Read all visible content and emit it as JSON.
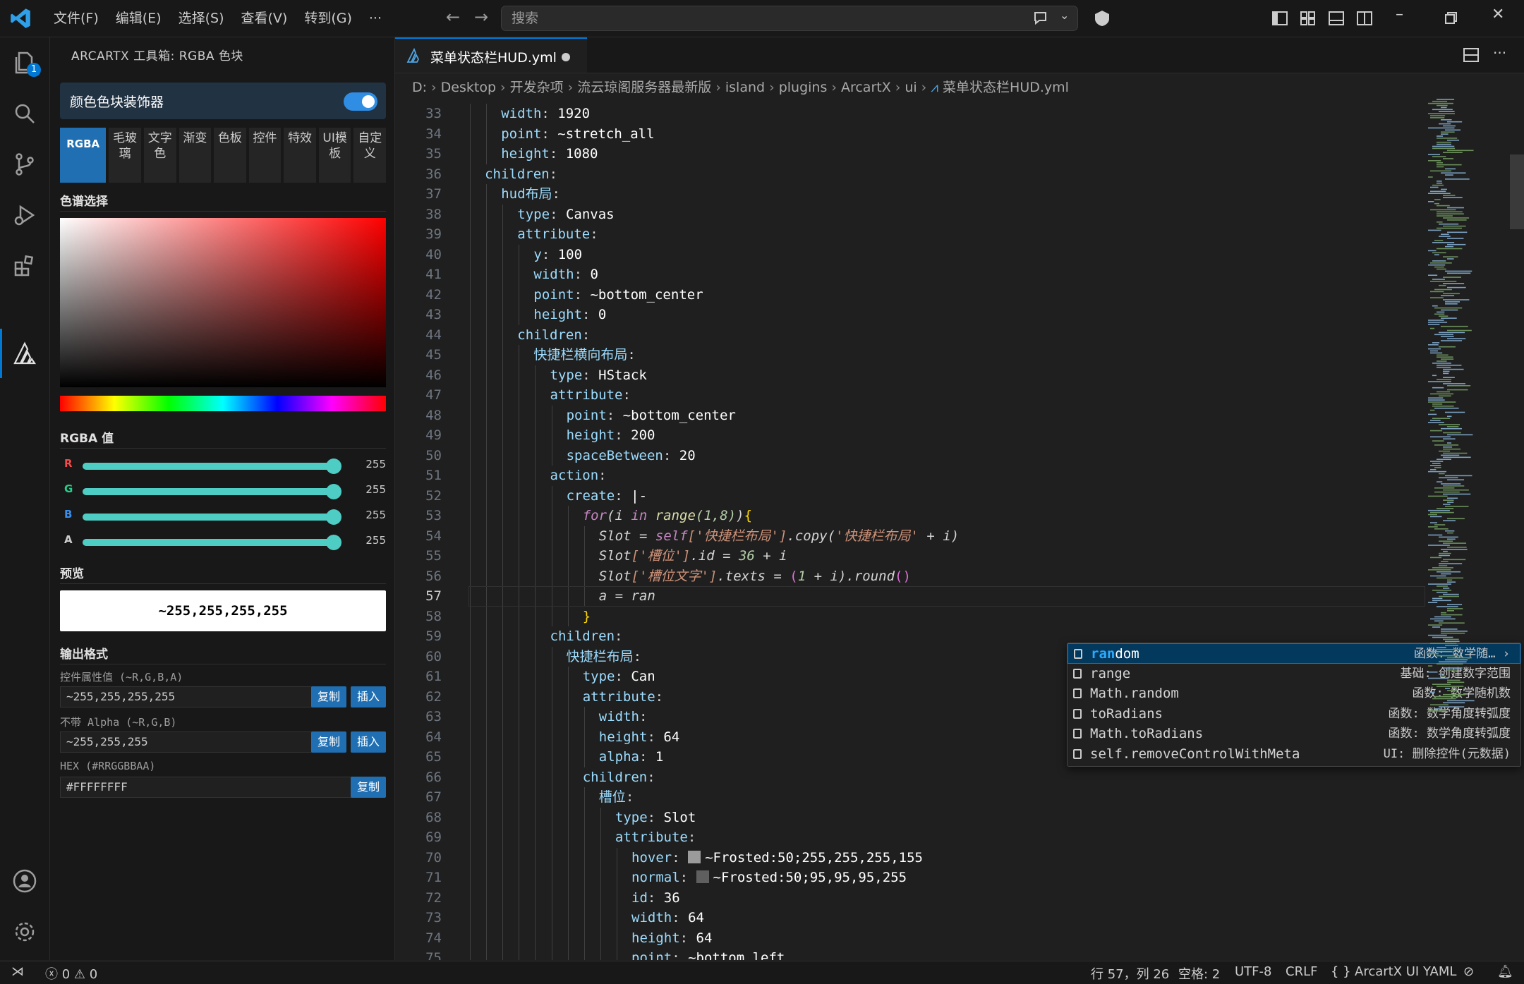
{
  "menu": {
    "file": "文件(F)",
    "edit": "编辑(E)",
    "select": "选择(S)",
    "view": "查看(V)",
    "goto": "转到(G)",
    "more": "···"
  },
  "search": {
    "placeholder": "搜索"
  },
  "activity": {
    "explorer_badge": "1"
  },
  "side": {
    "title": "ARCARTX 工具箱: RGBA 色块",
    "toggle_label": "颜色色块装饰器",
    "tabs": [
      "RGBA",
      "毛玻璃",
      "文字色",
      "渐变",
      "色板",
      "控件",
      "特效",
      "UI模板",
      "自定义"
    ],
    "spectrum_title": "色谱选择",
    "rgba_title": "RGBA 值",
    "channels": [
      {
        "label": "R",
        "value": "255",
        "color": "#f14c4c"
      },
      {
        "label": "G",
        "value": "255",
        "color": "#23d18b"
      },
      {
        "label": "B",
        "value": "255",
        "color": "#3b8eea"
      },
      {
        "label": "A",
        "value": "255",
        "color": "#cccccc"
      }
    ],
    "preview_title": "预览",
    "preview_value": "~255,255,255,255",
    "output_title": "输出格式",
    "outputs": [
      {
        "label": "控件属性值 (~R,G,B,A)",
        "value": "~255,255,255,255",
        "copy": "复制",
        "insert": "插入"
      },
      {
        "label": "不带 Alpha (~R,G,B)",
        "value": "~255,255,255",
        "copy": "复制",
        "insert": "插入"
      },
      {
        "label": "HEX (#RRGGBBAA)",
        "value": "#FFFFFFFF",
        "copy": "复制"
      }
    ]
  },
  "editor": {
    "tab_name": "菜单状态栏HUD.yml",
    "breadcrumb": [
      "D:",
      "Desktop",
      "开发杂项",
      "流云琼阁服务器最新版",
      "island",
      "plugins",
      "ArcartX",
      "ui",
      "菜单状态栏HUD.yml"
    ]
  },
  "code": [
    {
      "n": "33",
      "i": 3,
      "k": "width",
      "v": "1920"
    },
    {
      "n": "34",
      "i": 3,
      "k": "point",
      "v": "~stretch_all"
    },
    {
      "n": "35",
      "i": 3,
      "k": "height",
      "v": "1080"
    },
    {
      "n": "36",
      "i": 2,
      "k": "children",
      "v": ""
    },
    {
      "n": "37",
      "i": 3,
      "k": "hud布局",
      "v": ""
    },
    {
      "n": "38",
      "i": 4,
      "k": "type",
      "v": "Canvas"
    },
    {
      "n": "39",
      "i": 4,
      "k": "attribute",
      "v": ""
    },
    {
      "n": "40",
      "i": 5,
      "k": "y",
      "v": "100"
    },
    {
      "n": "41",
      "i": 5,
      "k": "width",
      "v": "0"
    },
    {
      "n": "42",
      "i": 5,
      "k": "point",
      "v": "~bottom_center"
    },
    {
      "n": "43",
      "i": 5,
      "k": "height",
      "v": "0"
    },
    {
      "n": "44",
      "i": 4,
      "k": "children",
      "v": ""
    },
    {
      "n": "45",
      "i": 5,
      "k": "快捷栏横向布局",
      "v": ""
    },
    {
      "n": "46",
      "i": 6,
      "k": "type",
      "v": "HStack"
    },
    {
      "n": "47",
      "i": 6,
      "k": "attribute",
      "v": ""
    },
    {
      "n": "48",
      "i": 7,
      "k": "point",
      "v": "~bottom_center"
    },
    {
      "n": "49",
      "i": 7,
      "k": "height",
      "v": "200"
    },
    {
      "n": "50",
      "i": 7,
      "k": "spaceBetween",
      "v": "20"
    },
    {
      "n": "51",
      "i": 6,
      "k": "action",
      "v": ""
    },
    {
      "n": "52",
      "i": 7,
      "k": "create",
      "v": "|-"
    },
    {
      "n": "53",
      "script": "for"
    },
    {
      "n": "54",
      "script": "slot1"
    },
    {
      "n": "55",
      "script": "slot2"
    },
    {
      "n": "56",
      "script": "slot3"
    },
    {
      "n": "57",
      "script": "cur"
    },
    {
      "n": "58",
      "script": "close"
    },
    {
      "n": "59",
      "i": 6,
      "k": "children",
      "v": ""
    },
    {
      "n": "60",
      "i": 7,
      "k": "快捷栏布局",
      "v": ""
    },
    {
      "n": "61",
      "i": 8,
      "k": "type",
      "v": "Can"
    },
    {
      "n": "62",
      "i": 8,
      "k": "attribute",
      "v": ""
    },
    {
      "n": "63",
      "i": 9,
      "k": "width",
      "v": ""
    },
    {
      "n": "64",
      "i": 9,
      "k": "height",
      "v": "64"
    },
    {
      "n": "65",
      "i": 9,
      "k": "alpha",
      "v": "1"
    },
    {
      "n": "66",
      "i": 8,
      "k": "children",
      "v": ""
    },
    {
      "n": "67",
      "i": 9,
      "k": "槽位",
      "v": ""
    },
    {
      "n": "68",
      "i": 10,
      "k": "type",
      "v": "Slot"
    },
    {
      "n": "69",
      "i": 10,
      "k": "attribute",
      "v": ""
    },
    {
      "n": "70",
      "i": 11,
      "k": "hover",
      "v": "~Frosted:50;255,255,255,155",
      "sw": "#9b9b9b"
    },
    {
      "n": "71",
      "i": 11,
      "k": "normal",
      "v": "~Frosted:50;95,95,95,255",
      "sw": "#5f5f5f"
    },
    {
      "n": "72",
      "i": 11,
      "k": "id",
      "v": "36"
    },
    {
      "n": "73",
      "i": 11,
      "k": "width",
      "v": "64"
    },
    {
      "n": "74",
      "i": 11,
      "k": "height",
      "v": "64"
    },
    {
      "n": "75",
      "i": 11,
      "k": "point",
      "v": "~bottom_left"
    }
  ],
  "script_text": {
    "for_kw": "for",
    "for_open": "(",
    "for_var": "i",
    "for_in": "in",
    "for_fn": "range",
    "for_args": "(1,8)",
    "for_close": ")",
    "for_brace": "{",
    "slot1_a": "Slot = ",
    "slot1_b": "self",
    "slot1_c": "['快捷栏布局']",
    "slot1_d": ".copy(",
    "slot1_e": "'快捷栏布局'",
    "slot1_f": " + i)",
    "slot2_a": "Slot",
    "slot2_b": "['槽位']",
    "slot2_c": ".id = ",
    "slot2_d": "36",
    "slot2_e": " + i",
    "slot3_a": "Slot",
    "slot3_b": "['槽位文字']",
    "slot3_c": ".texts = ",
    "slot3_d": "(",
    "slot3_e": "1",
    "slot3_f": " + i).round",
    "slot3_g": "()",
    "cur_text": "a = ran",
    "close_brace": "}"
  },
  "suggestions": [
    {
      "match": "ran",
      "rest": "dom",
      "detail": "函数: 数学随… ›"
    },
    {
      "match": "",
      "rest": "range",
      "detail": "基础: 创建数字范围"
    },
    {
      "match": "",
      "rest": "Math.random",
      "detail": "函数: 数学随机数"
    },
    {
      "match": "",
      "rest": "toRadians",
      "detail": "函数: 数学角度转弧度"
    },
    {
      "match": "",
      "rest": "Math.toRadians",
      "detail": "函数: 数学角度转弧度"
    },
    {
      "match": "",
      "rest": "self.removeControlWithMeta",
      "detail": "UI: 删除控件(元数据)"
    }
  ],
  "status": {
    "errors": "0",
    "warnings": "0",
    "position": "行 57，列 26",
    "spaces": "空格: 2",
    "encoding": "UTF-8",
    "eol": "CRLF",
    "language": "ArcartX UI YAML"
  },
  "colors": {
    "accent": "#0078d4",
    "toggle": "#2f8de4",
    "slider": "#4ecdc4",
    "button": "#1f6fb2"
  }
}
